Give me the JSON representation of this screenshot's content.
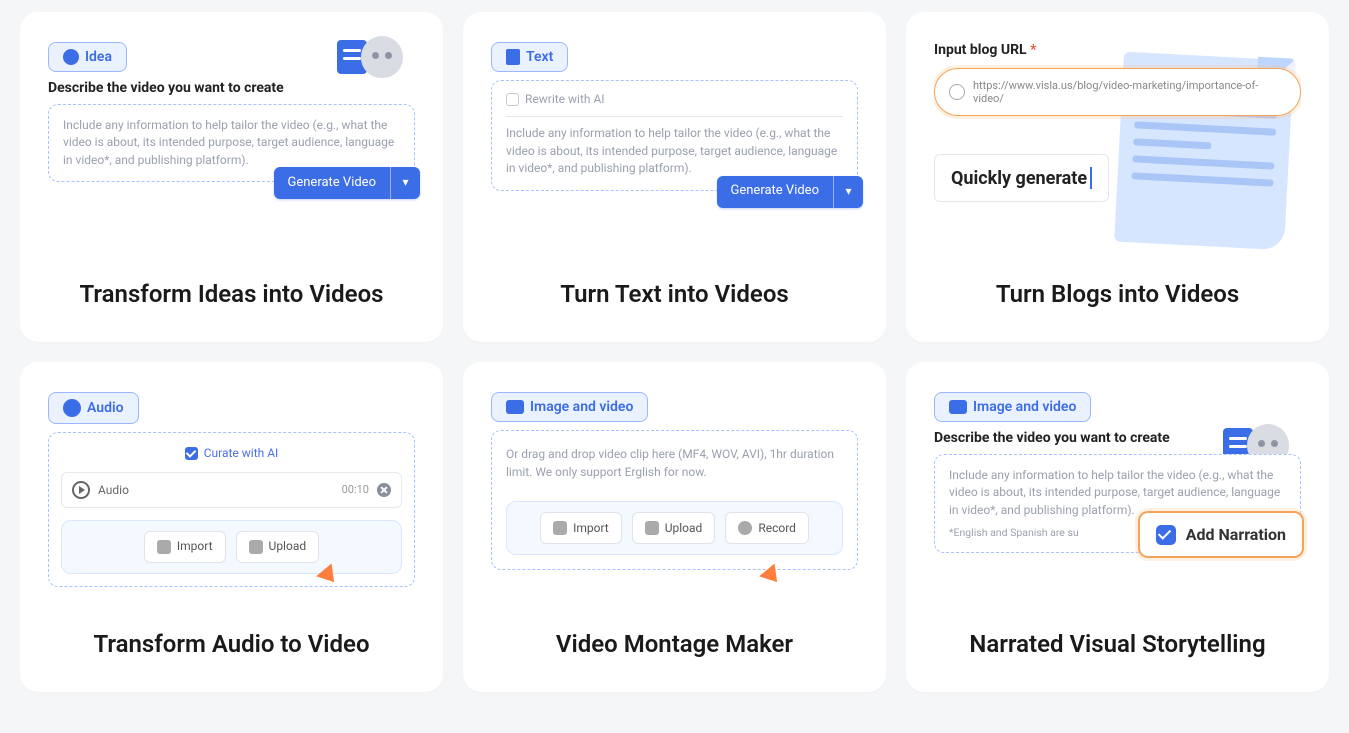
{
  "cards": {
    "idea": {
      "tag": "Idea",
      "subhead": "Describe the video you want to create",
      "placeholder": "Include any information to help tailor the video (e.g., what the video is about,  its intended purpose, target audience, language in video*, and publishing platform).",
      "button": "Generate Video",
      "title": "Transform Ideas into Videos"
    },
    "text": {
      "tag": "Text",
      "rewrite": "Rewrite with AI",
      "placeholder": "Include any information to help tailor the video (e.g., what the video is about,  its intended purpose, target audience, language in video*, and publishing platform).",
      "button": "Generate Video",
      "title": "Turn Text into Videos"
    },
    "blog": {
      "label": "Input blog URL",
      "url": "https://www.visla.us/blog/video-marketing/importance-of-video/",
      "quickgen": "Quickly generate",
      "title": "Turn Blogs into Videos"
    },
    "audio": {
      "tag": "Audio",
      "curate": "Curate with AI",
      "track": "Audio",
      "time": "00:10",
      "import_btn": "Import",
      "upload_btn": "Upload",
      "title": "Transform Audio to Video"
    },
    "montage": {
      "tag": "Image and video",
      "drag_text": "Or drag and drop video clip here (MF4, WOV, AVI), 1hr duration limit. We only support Erglish for now.",
      "import_btn": "Import",
      "upload_btn": "Upload",
      "record_btn": "Record",
      "title": "Video Montage Maker"
    },
    "narration": {
      "tag": "Image and video",
      "subhead": "Describe the video you want to create",
      "placeholder": "Include any information to help tailor the video (e.g., what the video is about,  its intended purpose, target audience, language in video*, and publishing platform).",
      "footnote": "*English and Spanish are su",
      "add_narration": "Add Narration",
      "title": "Narrated Visual Storytelling"
    }
  }
}
